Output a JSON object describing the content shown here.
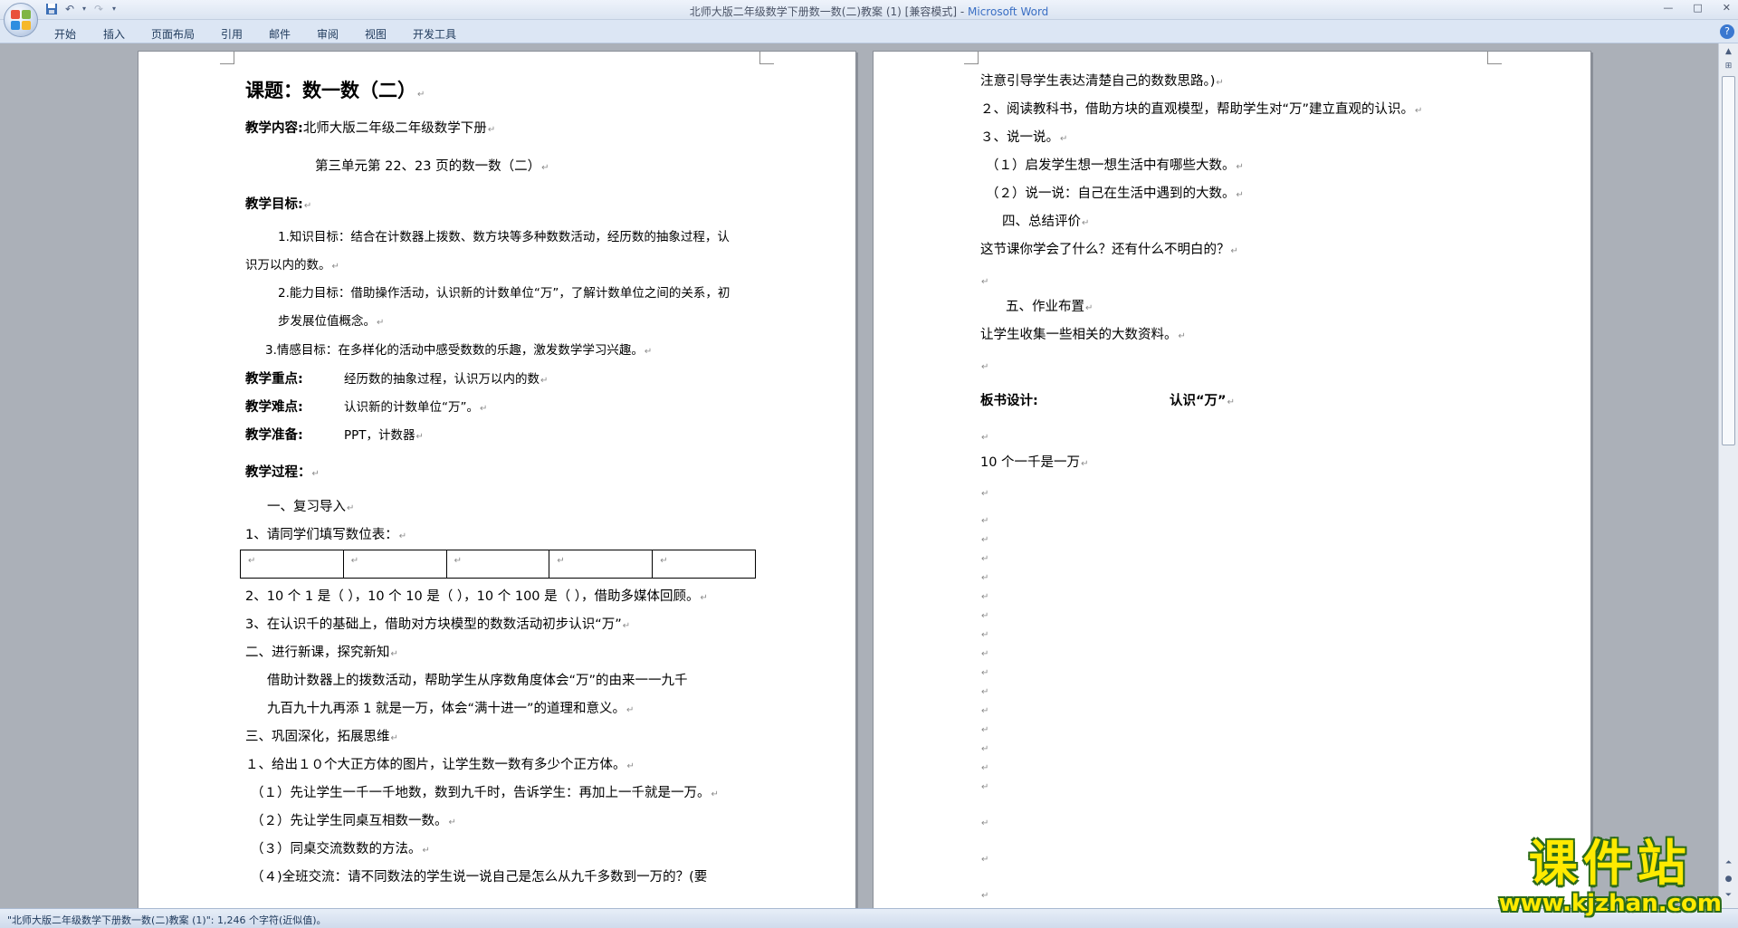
{
  "window": {
    "title": "北师大版二年级数学下册数一数(二)教案 (1) [兼容模式] - ",
    "app_name": "Microsoft Word"
  },
  "ribbon": {
    "tabs": [
      "开始",
      "插入",
      "页面布局",
      "引用",
      "邮件",
      "审阅",
      "视图",
      "开发工具"
    ]
  },
  "left_page": {
    "title": "课题：数一数（二）",
    "content_label": "教学内容:",
    "content_value": "北师大版二年级二年级数学下册",
    "content_line2": "第三单元第 22、23 页的数一数（二）",
    "goals_label": "教学目标:",
    "goal1_a": "1.知识目标：结合在计数器上拨数、数方块等多种数数活动，经历数的抽象过程，认",
    "goal1_b": "识万以内的数。",
    "goal2_a": "2.能力目标：借助操作活动，认识新的计数单位“万”，了解计数单位之间的关系，初",
    "goal2_b": "步发展位值概念。",
    "goal3": "3.情感目标：在多样化的活动中感受数数的乐趣，激发数学学习兴趣。",
    "key_label": "教学重点:",
    "key_value": "经历数的抽象过程，认识万以内的数",
    "diff_label": "教学难点:",
    "diff_value": "认识新的计数单位“万”。",
    "prep_label": "教学准备:",
    "prep_value": "PPT，计数器",
    "process_label": "教学过程：",
    "sec1": "一、复习导入",
    "q1": "1、请同学们填写数位表：",
    "q2": "2、10 个 1 是（    ），10 个 10 是（    ），10 个 100 是（    ），借助多媒体回顾。",
    "q3": "3、在认识千的基础上，借助对方块模型的数数活动初步认识“万”",
    "sec2": "二、进行新课，探究新知",
    "p2a": "借助计数器上的拨数活动，帮助学生从序数角度体会“万”的由来一一九千",
    "p2b": "九百九十九再添 1 就是一万，体会“满十进一”的道理和意义。",
    "sec3": "三、巩固深化，拓展思维",
    "s3_1": "１、给出１０个大正方体的图片，让学生数一数有多少个正方体。",
    "s3_1a": "（１）先让学生一千一千地数，数到九千时，告诉学生：再加上一千就是一万。",
    "s3_1b": "（２）先让学生同桌互相数一数。",
    "s3_1c": "（３）同桌交流数数的方法。",
    "s3_1d": "（４)全班交流：请不同数法的学生说一说自己是怎么从九千多数到一万的？(要"
  },
  "right_page": {
    "r1": "注意引导学生表达清楚自己的数数思路。)",
    "r2": "２、阅读教科书，借助方块的直观模型，帮助学生对“万”建立直观的认识。",
    "r3": "３、说一说。",
    "r4": "（１）启发学生想一想生活中有哪些大数。",
    "r5": "（２）说一说：自己在生活中遇到的大数。",
    "r6": "四、总结评价",
    "r7": "这节课你学会了什么？还有什么不明白的？",
    "r8": "五、作业布置",
    "r9": "让学生收集一些相关的大数资料。",
    "board_label": "板书设计:",
    "board_value": "认识“万”",
    "r10": "10 个一千是一万"
  },
  "status": {
    "text": "\"北师大版二年级数学下册数一数(二)教案 (1)\": 1,246 个字符(近似值)。"
  },
  "watermark": {
    "line1": "课件站",
    "line2": "www.kjzhan.com"
  },
  "colors": {
    "ribbon_bg": "#dce6f4",
    "workspace_bg": "#abb0b8",
    "watermark_fill": "#ffea00",
    "watermark_outline": "#2c6b1a"
  }
}
